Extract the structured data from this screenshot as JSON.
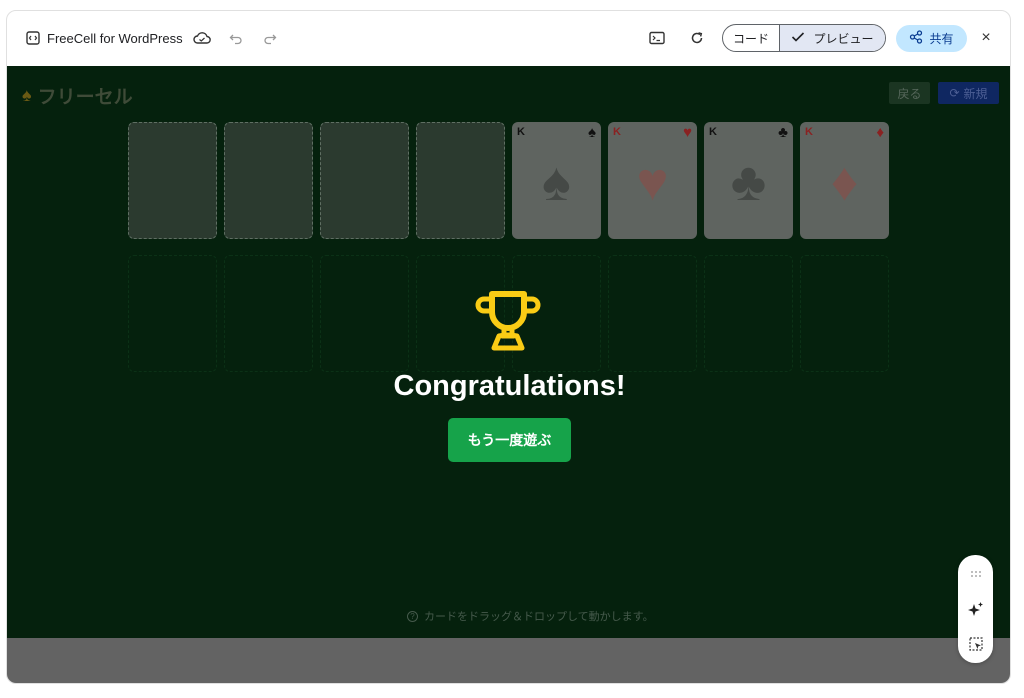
{
  "topbar": {
    "app_title": "FreeCell for WordPress",
    "code_label": "コード",
    "preview_label": "プレビュー",
    "share_label": "共有",
    "close_label": "×"
  },
  "game": {
    "title": "フリーセル",
    "back_label": "戻る",
    "new_label": "新規",
    "foundations": [
      {
        "rank": "K",
        "suit": "♠",
        "color": "#000000"
      },
      {
        "rank": "K",
        "suit": "♥",
        "color": "#c62828"
      },
      {
        "rank": "K",
        "suit": "♣",
        "color": "#000000"
      },
      {
        "rank": "K",
        "suit": "♦",
        "color": "#c62828"
      }
    ],
    "hint": "カードをドラッグ＆ドロップして動かします。"
  },
  "overlay": {
    "message": "Congratulations!",
    "play_again_label": "もう一度遊ぶ",
    "trophy_color": "#facc15"
  },
  "colors": {
    "accent_green": "#16a34a",
    "felt": "#05210d",
    "share_bg": "#c2e7ff"
  }
}
